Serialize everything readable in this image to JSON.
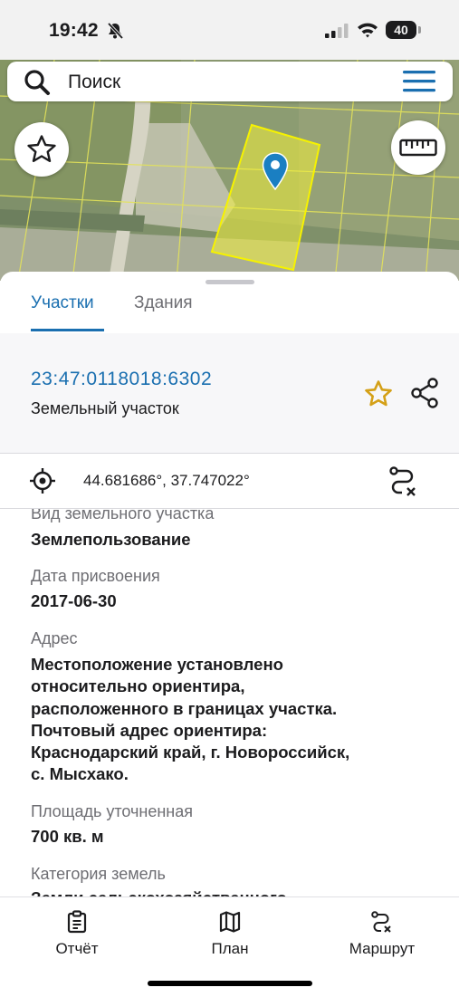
{
  "status_bar": {
    "time": "19:42",
    "battery": "40"
  },
  "search": {
    "text": "Поиск"
  },
  "tabs": [
    {
      "label": "Участки",
      "active": true
    },
    {
      "label": "Здания",
      "active": false
    }
  ],
  "parcel": {
    "cadastral_number": "23:47:0118018:6302",
    "type": "Земельный участок",
    "coordinates": "44.681686°, 37.747022°"
  },
  "fields": [
    {
      "label": "Вид земельного участка",
      "value": [
        "Землепользование"
      ]
    },
    {
      "label": "Дата присвоения",
      "value": [
        "2017-06-30"
      ]
    },
    {
      "label": "Адрес",
      "value": [
        "Местоположение установлено",
        "относительно ориентира,",
        "расположенного в границах участка.",
        "Почтовый адрес ориентира:",
        "Краснодарский край, г. Новороссийск,",
        "с. Мысхако."
      ]
    },
    {
      "label": "Площадь уточненная",
      "value": [
        "700 кв. м"
      ]
    },
    {
      "label": "Категория земель",
      "value": [
        "Земли сельскохозяйственного"
      ]
    }
  ],
  "bottom_nav": [
    {
      "label": "Отчёт",
      "icon": "clipboard-icon"
    },
    {
      "label": "План",
      "icon": "map-icon"
    },
    {
      "label": "Маршрут",
      "icon": "route-icon"
    }
  ],
  "colors": {
    "accent": "#1a6fb0",
    "parcel_highlight": "#f2f03a",
    "star": "#d4a017"
  }
}
